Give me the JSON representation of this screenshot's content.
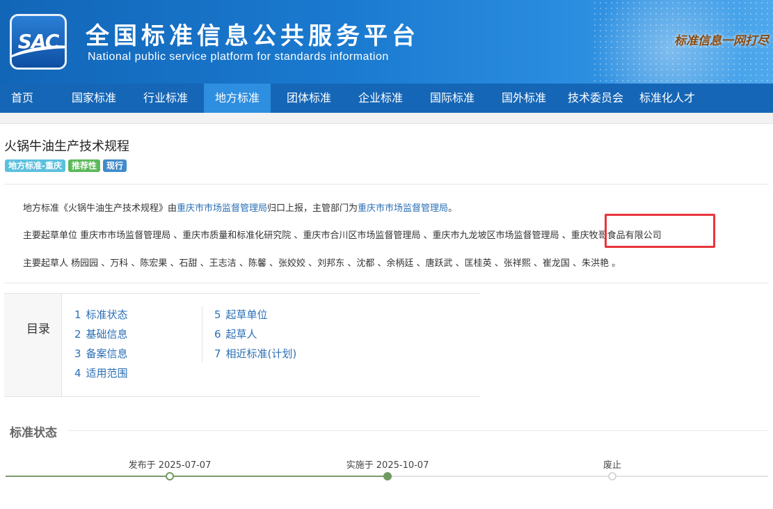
{
  "header": {
    "logo_text": "SAC",
    "title": "全国标准信息公共服务平台",
    "subtitle": "National public service platform  for standards information",
    "slogan": "标准信息一网打尽"
  },
  "nav": {
    "items": [
      {
        "label": "首页"
      },
      {
        "label": "国家标准"
      },
      {
        "label": "行业标准"
      },
      {
        "label": "地方标准"
      },
      {
        "label": "团体标准"
      },
      {
        "label": "企业标准"
      },
      {
        "label": "国际标准"
      },
      {
        "label": "国外标准"
      },
      {
        "label": "技术委员会"
      },
      {
        "label": "标准化人才"
      }
    ],
    "active": "地方标准"
  },
  "standard": {
    "title": "火锅牛油生产技术规程",
    "badges": {
      "type": "地方标准-重庆",
      "nature": "推荐性",
      "status": "现行"
    }
  },
  "info": {
    "line1": {
      "prefix": "地方标准《火锅牛油生产技术规程》由",
      "org1": "重庆市市场监督管理局",
      "middle": "归口上报，主管部门为",
      "org2": "重庆市市场监督管理局",
      "suffix": "。"
    },
    "drafting_units_label": "主要起草单位",
    "drafting_units": "重庆市市场监督管理局 、重庆市质量和标准化研究院 、重庆市合川区市场监督管理局 、重庆市九龙坡区市场监督管理局 、重庆牧哥食品有限公司",
    "drafters_label": "主要起草人",
    "drafters": "杨园园 、万科 、陈宏果 、石甜 、王志洁 、陈馨 、张姣姣 、刘邦东 、沈都 、余柄廷 、唐跃武 、匡桂英 、张祥熙 、崔龙国 、朱洪艳 。"
  },
  "toc": {
    "label": "目录",
    "items": [
      {
        "num": "1",
        "label": "标准状态"
      },
      {
        "num": "2",
        "label": "基础信息"
      },
      {
        "num": "3",
        "label": "备案信息"
      },
      {
        "num": "4",
        "label": "适用范围"
      },
      {
        "num": "5",
        "label": "起草单位"
      },
      {
        "num": "6",
        "label": "起草人"
      },
      {
        "num": "7",
        "label": "相近标准(计划)"
      }
    ]
  },
  "status_section": {
    "title": "标准状态",
    "timeline": [
      {
        "label": "发布于 2025-07-07",
        "state": "done"
      },
      {
        "label": "实施于 2025-10-07",
        "state": "current"
      },
      {
        "label": "废止",
        "state": "pending"
      }
    ]
  },
  "colors": {
    "nav_bg": "#1566b6",
    "nav_active": "#2e8ee0",
    "link": "#2a6fb5",
    "highlight": "#e8343c",
    "timeline": "#6f9a5f"
  }
}
